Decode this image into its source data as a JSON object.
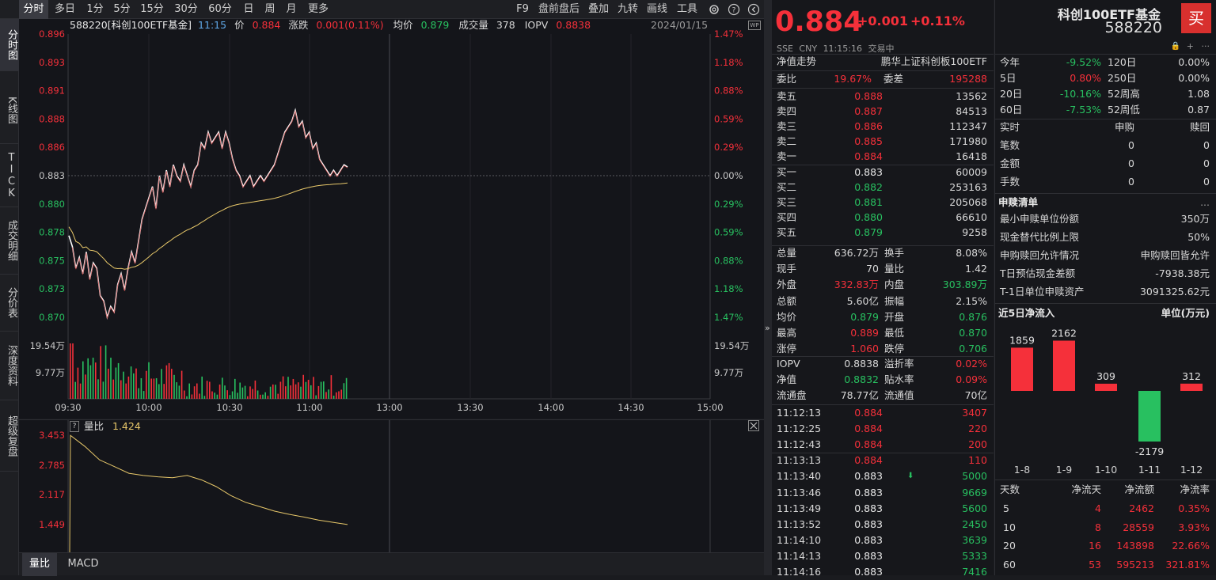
{
  "toolbar": {
    "left": [
      "分时",
      "多日",
      "1分",
      "5分",
      "15分",
      "30分",
      "60分",
      "日",
      "周",
      "月",
      "更多"
    ],
    "right": [
      "F9",
      "盘前盘后",
      "叠加",
      "九转",
      "画线",
      "工具"
    ]
  },
  "leftnav": [
    "分时图",
    "K线图",
    "TICK",
    "成交明细",
    "分价表",
    "深度资料",
    "超级复盘"
  ],
  "infobar": {
    "code": "588220[科创100ETF基金]",
    "time": "11:15",
    "price_label": "价",
    "price": "0.884",
    "change_label": "涨跌",
    "change": "0.001(0.11%)",
    "avg_label": "均价",
    "avg": "0.879",
    "vol_label": "成交量",
    "vol": "378",
    "iopv_label": "IOPV",
    "iopv": "0.8838",
    "date": "2024/01/15",
    "wp": "WP"
  },
  "chart_data": [
    {
      "type": "line",
      "title": "",
      "x": [
        "09:30",
        "10:00",
        "10:30",
        "11:00",
        "11:15"
      ],
      "series": [],
      "y_ticks_left": [
        "0.896",
        "0.893",
        "0.891",
        "0.888",
        "0.886",
        "0.883",
        "0.880",
        "0.878",
        "0.875",
        "0.873",
        "0.870"
      ],
      "y_ticks_right": [
        "1.47%",
        "1.18%",
        "0.88%",
        "0.59%",
        "0.29%",
        "0.00%",
        "0.29%",
        "0.59%",
        "0.88%",
        "1.18%",
        "1.47%"
      ],
      "ylim": [
        0.87,
        0.896
      ],
      "prev_close": 0.883,
      "x_ticks": [
        "09:30",
        "10:00",
        "10:30",
        "11:00",
        "13:00",
        "13:30",
        "14:00",
        "14:30",
        "15:00"
      ],
      "volume_ticks_left": [
        "19.54万",
        "9.77万"
      ],
      "volume_ticks_right": [
        "19.54万",
        "9.77万"
      ]
    },
    {
      "type": "line",
      "title": "量比",
      "value_label": "1.424",
      "y_ticks": [
        "3.453",
        "2.785",
        "2.117",
        "1.449"
      ],
      "series": [
        {
          "values": [
            3.45,
            3.2,
            2.9,
            2.75,
            2.6,
            2.55,
            2.52,
            2.5,
            2.55,
            2.45,
            2.3,
            2.1,
            1.95,
            1.85,
            1.75,
            1.68,
            1.62,
            1.55,
            1.5,
            1.45
          ]
        }
      ]
    }
  ],
  "bottomtabs": [
    "量比",
    "MACD"
  ],
  "quote": {
    "price": "0.884",
    "change": "+0.001",
    "pct": "+0.11%",
    "name": "科创100ETF基金",
    "code": "588220",
    "buy": "买",
    "exch": "SSE",
    "cur": "CNY",
    "time": "11:15:16",
    "status": "交易中"
  },
  "nav": {
    "label": "净值走势",
    "index": "鹏华上证科创板100ETF"
  },
  "weibi": {
    "wb_label": "委比",
    "wb": "19.67%",
    "wc_label": "委差",
    "wc": "195288"
  },
  "asks": [
    {
      "l": "卖五",
      "p": "0.888",
      "v": "13562"
    },
    {
      "l": "卖四",
      "p": "0.887",
      "v": "84513"
    },
    {
      "l": "卖三",
      "p": "0.886",
      "v": "112347"
    },
    {
      "l": "卖二",
      "p": "0.885",
      "v": "171980"
    },
    {
      "l": "卖一",
      "p": "0.884",
      "v": "16418"
    }
  ],
  "bids": [
    {
      "l": "买一",
      "p": "0.883",
      "v": "60009"
    },
    {
      "l": "买二",
      "p": "0.882",
      "v": "253163"
    },
    {
      "l": "买三",
      "p": "0.881",
      "v": "205068"
    },
    {
      "l": "买四",
      "p": "0.880",
      "v": "66610"
    },
    {
      "l": "买五",
      "p": "0.879",
      "v": "9258"
    }
  ],
  "stats": [
    {
      "a": "总量",
      "b": "636.72万",
      "c": "换手",
      "d": "8.08%"
    },
    {
      "a": "现手",
      "b": "70",
      "c": "量比",
      "d": "1.42"
    },
    {
      "a": "外盘",
      "b": "332.83万",
      "c": "内盘",
      "d": "303.89万"
    },
    {
      "a": "总额",
      "b": "5.60亿",
      "c": "振幅",
      "d": "2.15%"
    },
    {
      "a": "均价",
      "b": "0.879",
      "c": "开盘",
      "d": "0.876"
    },
    {
      "a": "最高",
      "b": "0.889",
      "c": "最低",
      "d": "0.870"
    },
    {
      "a": "涨停",
      "b": "1.060",
      "c": "跌停",
      "d": "0.706"
    }
  ],
  "iopv": [
    {
      "a": "IOPV",
      "b": "0.8838",
      "c": "溢折率",
      "d": "0.02%"
    },
    {
      "a": "净值",
      "b": "0.8832",
      "c": "贴水率",
      "d": "0.09%"
    },
    {
      "a": "流通盘",
      "b": "78.77亿",
      "c": "流通值",
      "d": "70亿"
    }
  ],
  "ticks": [
    {
      "t": "11:12:13",
      "p": "0.884",
      "v": "3407"
    },
    {
      "t": "11:12:25",
      "p": "0.884",
      "v": "220"
    },
    {
      "t": "11:12:43",
      "p": "0.884",
      "v": "200"
    },
    {
      "t": "11:13:13",
      "p": "0.884",
      "v": "110"
    },
    {
      "t": "11:13:40",
      "p": "0.883",
      "v": "5000"
    },
    {
      "t": "11:13:46",
      "p": "0.883",
      "v": "9669"
    },
    {
      "t": "11:13:49",
      "p": "0.883",
      "v": "5600"
    },
    {
      "t": "11:13:52",
      "p": "0.883",
      "v": "2450"
    },
    {
      "t": "11:14:10",
      "p": "0.883",
      "v": "3639"
    },
    {
      "t": "11:14:13",
      "p": "0.883",
      "v": "5333"
    },
    {
      "t": "11:14:16",
      "p": "0.883",
      "v": "7416"
    }
  ],
  "perf": [
    {
      "a": "今年",
      "b": "-9.52%",
      "c": "120日",
      "d": "0.00%"
    },
    {
      "a": "5日",
      "b": "0.80%",
      "c": "250日",
      "d": "0.00%"
    },
    {
      "a": "20日",
      "b": "-10.16%",
      "c": "52周高",
      "d": "1.08"
    },
    {
      "a": "60日",
      "b": "-7.53%",
      "c": "52周低",
      "d": "0.87"
    }
  ],
  "realtime": {
    "h": [
      "实时",
      "申购",
      "赎回"
    ],
    "rows": [
      {
        "l": "笔数",
        "a": "0",
        "b": "0"
      },
      {
        "l": "金额",
        "a": "0",
        "b": "0"
      },
      {
        "l": "手数",
        "a": "0",
        "b": "0"
      }
    ]
  },
  "sg": {
    "title": "申赎清单",
    "dots": "...",
    "rows": [
      {
        "l": "最小申赎单位份额",
        "v": "350万"
      },
      {
        "l": "现金替代比例上限",
        "v": "50%"
      },
      {
        "l": "申购赎回允许情况",
        "v": "申购赎回皆允许"
      },
      {
        "l": "T日预估现金差额",
        "v": "-7938.38元"
      },
      {
        "l": "T-1日单位申赎资产",
        "v": "3091325.62元"
      }
    ]
  },
  "flow": {
    "title": "近5日净流入",
    "unit": "单位(万元)",
    "chart_data": {
      "type": "bar",
      "categories": [
        "1-8",
        "1-9",
        "1-10",
        "1-11",
        "1-12"
      ],
      "values": [
        1859,
        2162,
        309,
        -2179,
        312
      ]
    }
  },
  "flowtable": {
    "h": [
      "天数",
      "净流天",
      "净流额",
      "净流率"
    ],
    "rows": [
      {
        "a": "5",
        "b": "4",
        "c": "2462",
        "d": "0.35%"
      },
      {
        "a": "10",
        "b": "8",
        "c": "28559",
        "d": "3.93%"
      },
      {
        "a": "20",
        "b": "16",
        "c": "143898",
        "d": "22.66%"
      },
      {
        "a": "60",
        "b": "53",
        "c": "595213",
        "d": "321.81%"
      }
    ]
  },
  "colors": {
    "red": "#f5303a",
    "green": "#28c060",
    "yellow": "#e8c86a",
    "price_line": "#ffffff"
  }
}
